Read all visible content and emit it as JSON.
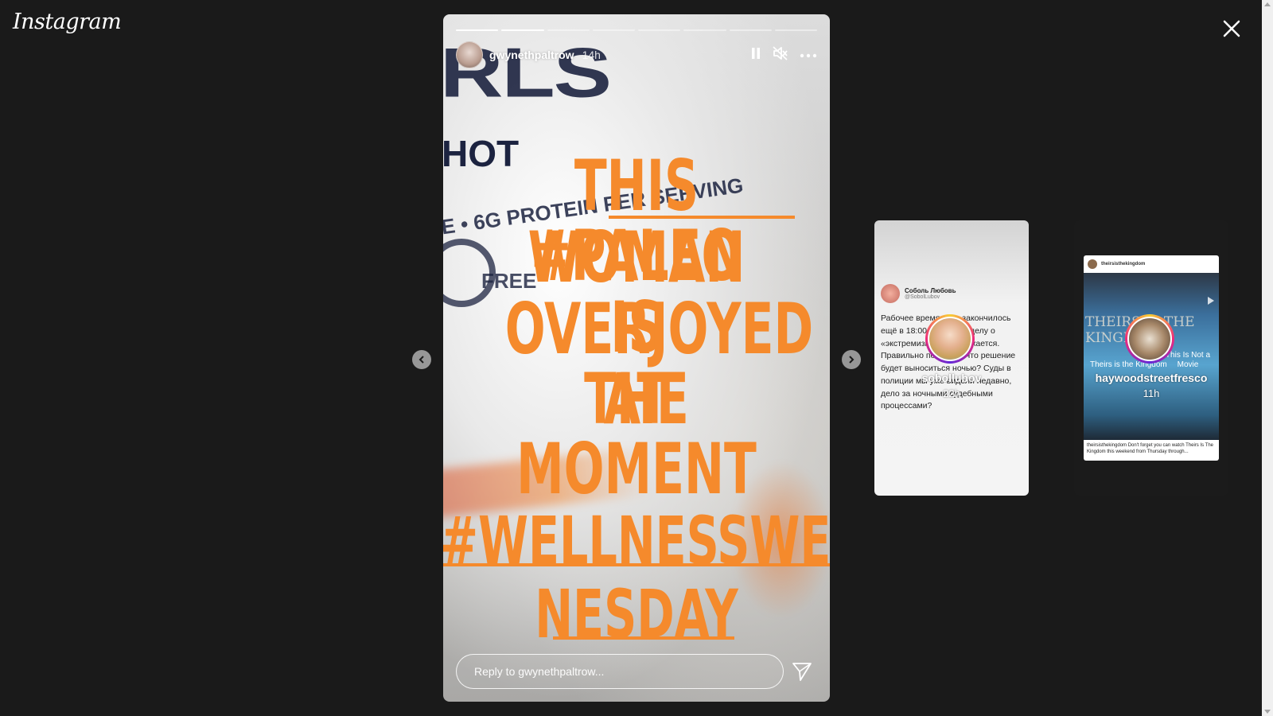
{
  "app": {
    "logo": "Instagram"
  },
  "story": {
    "username": "gwynethpaltrow",
    "time": "14h",
    "progress": {
      "total_segments": 8,
      "completed_segments": 2
    },
    "text_lines": [
      "THIS #PALEO",
      "WOMAN IS",
      "OVERJOYED AT",
      "THE MOMENT",
      "#WELLNESSWED",
      "NESDAY"
    ],
    "background_text": {
      "brand": "RLS",
      "hot": "HOT",
      "protein": "E • 6G PROTEIN PER SERVING",
      "free": "FREE",
      "mirrored": "SMHS VEGAN"
    },
    "reply_placeholder": "Reply to gwynethpaltrow...",
    "icons": {
      "pause": "pause-icon",
      "mute": "muted-speaker-icon",
      "more": "more-options-icon",
      "send": "send-icon"
    }
  },
  "previews": [
    {
      "username": "sobollubov",
      "time": "22h",
      "tweet": {
        "name": "Соболь Любовь",
        "handle": "@SobolLubov",
        "body": "Рабочее время суда закончилось ещё в 18:00, но суд по делу о «экстремизме» продолжается. Правильно понимаю, что решение будет выноситься ночью? Суды в полиции мы уже видели недавно, дело за ночными судебными процессами?"
      }
    },
    {
      "username": "haywoodstreetfresco",
      "time": "11h",
      "post": {
        "account": "theirsisthekingdom",
        "title1": "THEIRS IS THE KINGDOM",
        "title2": "This Is Not a Movie",
        "title3": "Theirs is the Kingdom",
        "caption": "theirsisthekingdom Don't forget you can watch Theirs Is The Kingdom this weekend from Thursday through..."
      }
    }
  ],
  "colors": {
    "story_text": "#f58a2c",
    "background": "#1a1a1a"
  }
}
